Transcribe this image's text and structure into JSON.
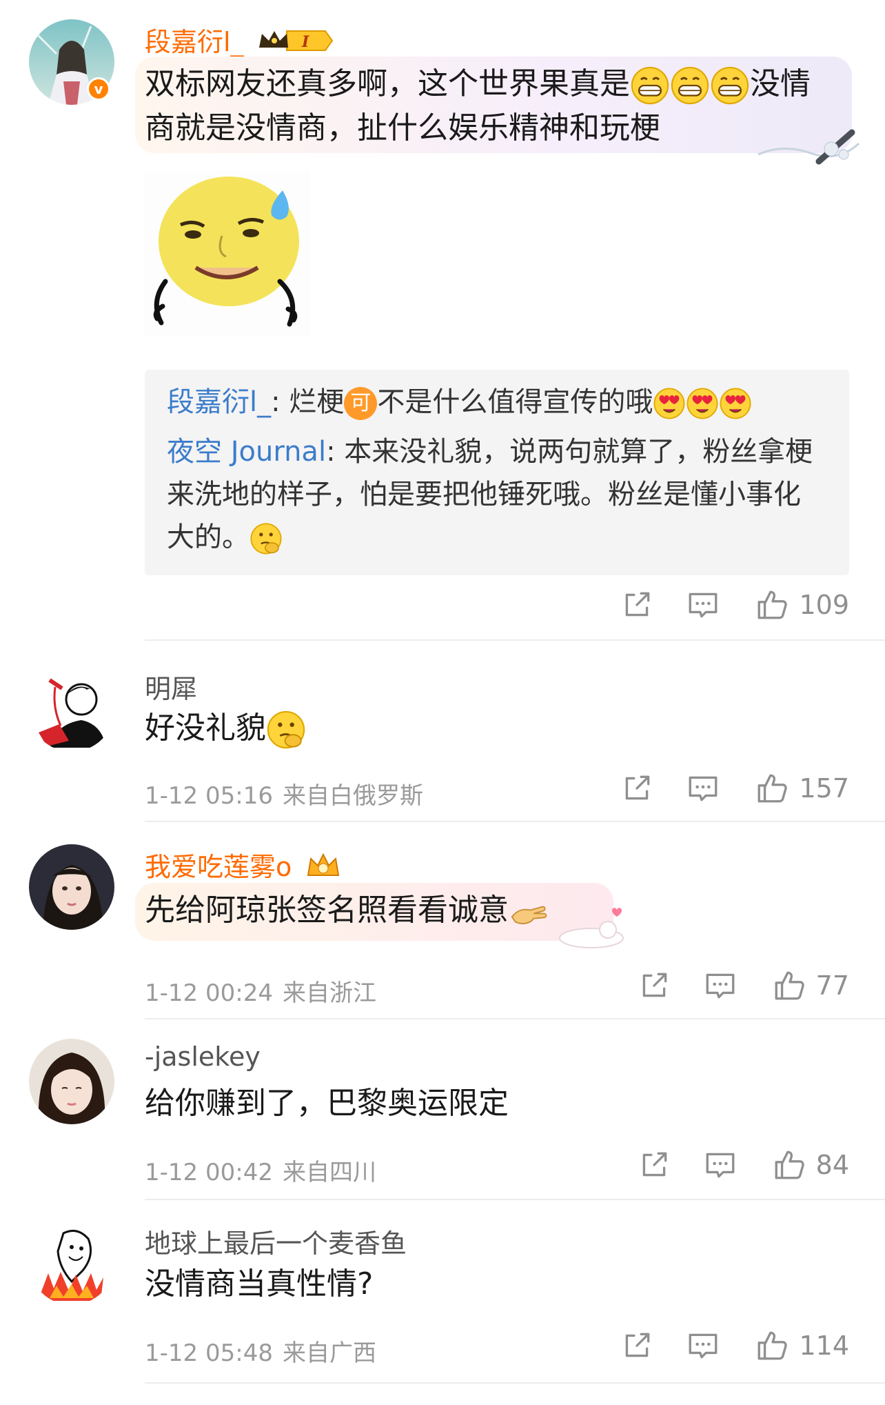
{
  "comments": [
    {
      "author": "段嘉衍l_",
      "level": "I",
      "text_line1_a": "双标网友还真多啊，这个世界果真是",
      "text_line1_b": "没情",
      "text_line2": "商就是没情商，扯什么娱乐精神和玩梗",
      "replies": [
        {
          "name": "段嘉衍l_",
          "sep": ": ",
          "text_a": "烂梗",
          "badge": "可",
          "text_b": "不是什么值得宣传的哦"
        },
        {
          "name": "夜空 Journal",
          "sep": ": ",
          "line1": "本来没礼貌，说两句就算了，粉丝拿梗",
          "line2": "来洗地的样子，怕是要把他锤死哦。粉丝是懂小事化",
          "line3": "大的。"
        }
      ],
      "likes": "109"
    },
    {
      "author": "明犀",
      "text": "好没礼貌",
      "time": "1-12 05:16",
      "location": "来自白俄罗斯",
      "likes": "157"
    },
    {
      "author": "我爱吃莲雾o",
      "text": "先给阿琼张签名照看看诚意",
      "time": "1-12 00:24",
      "location": "来自浙江",
      "likes": "77"
    },
    {
      "author": "-jaslekey",
      "text": "给你赚到了，巴黎奥运限定",
      "time": "1-12 00:42",
      "location": "来自四川",
      "likes": "84"
    },
    {
      "author": "地球上最后一个麦香鱼",
      "text": "没情商当真性情?",
      "time": "1-12 05:48",
      "location": "来自广西",
      "likes": "114"
    }
  ],
  "icons": {
    "share": "share-icon",
    "comment": "comment-icon",
    "like": "thumbs-up-icon",
    "verified": "verified-badge-icon",
    "crown": "crown-badge-icon"
  },
  "colors": {
    "vip_name": "#ff6a00",
    "reply_name": "#3c7ccb",
    "meta": "#9a9a9a",
    "verified": "#ff8200"
  }
}
